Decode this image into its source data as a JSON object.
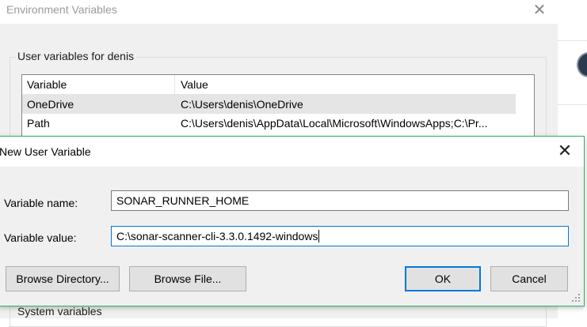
{
  "env_window": {
    "title": "Environment Variables",
    "close_glyph": "✕",
    "user_group_label": "User variables for denis",
    "columns": {
      "variable": "Variable",
      "value": "Value"
    },
    "rows": [
      {
        "variable": "OneDrive",
        "value": "C:\\Users\\denis\\OneDrive"
      },
      {
        "variable": "Path",
        "value": "C:\\Users\\denis\\AppData\\Local\\Microsoft\\WindowsApps;C:\\Pr..."
      }
    ],
    "system_group_label": "System variables"
  },
  "dialog": {
    "title": "New User Variable",
    "close_glyph": "✕",
    "variable_name_label": "Variable name:",
    "variable_name_value": "SONAR_RUNNER_HOME",
    "variable_value_label": "Variable value:",
    "variable_value_value": "C:\\sonar-scanner-cli-3.3.0.1492-windows",
    "browse_directory_label": "Browse Directory...",
    "browse_file_label": "Browse File...",
    "ok_label": "OK",
    "cancel_label": "Cancel"
  },
  "colors": {
    "dialog_border": "#2fb36b",
    "focus_blue": "#0078d7"
  },
  "icons": {
    "close": "close-icon",
    "avatar": "avatar",
    "resize": "resize-grip-icon"
  }
}
